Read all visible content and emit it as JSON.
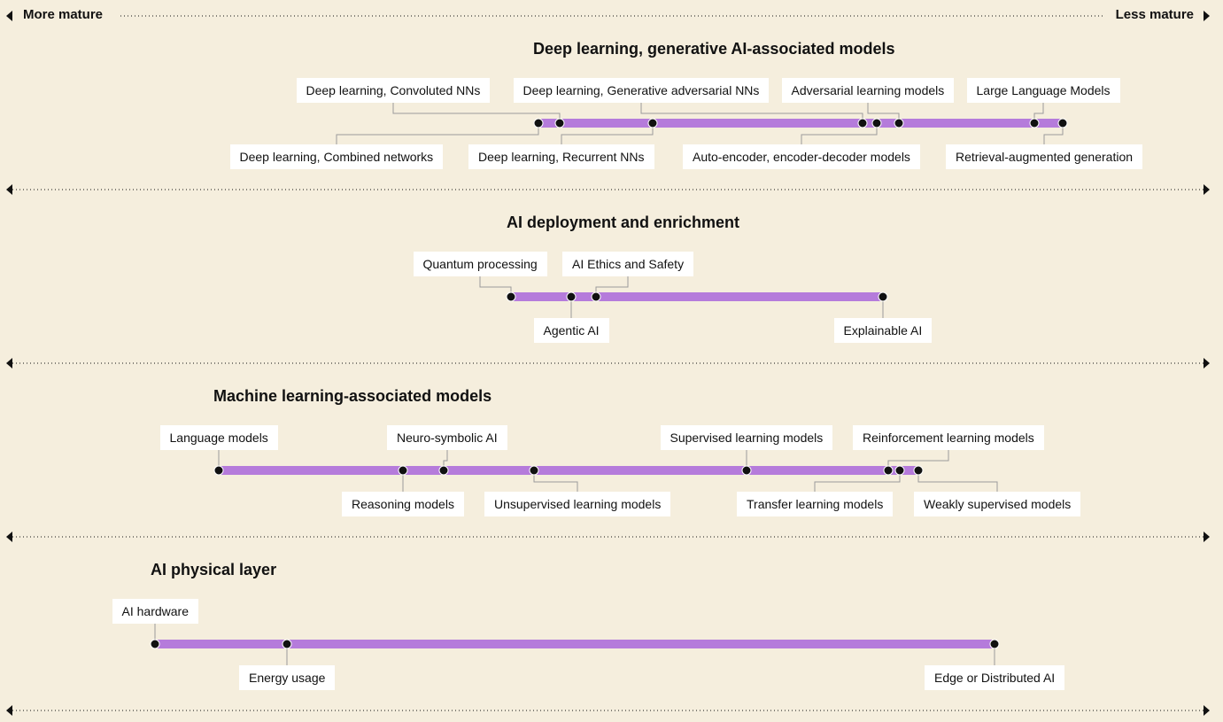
{
  "header": {
    "left_label": "More mature",
    "right_label": "Less mature"
  },
  "colors": {
    "background": "#f5eedd",
    "bar": "#b57bdb",
    "dot": "#111111",
    "label_bg": "#ffffff",
    "leader": "#9a9a9a",
    "dotted_axis": "#111111"
  },
  "chart_data": {
    "type": "timeline",
    "axis": {
      "left": "More mature",
      "right": "Less mature",
      "direction": "maturity"
    },
    "groups": [
      {
        "title": "Deep learning, generative AI-associated models",
        "items": [
          {
            "label": "Deep learning, Combined networks",
            "position": 608,
            "side": "below"
          },
          {
            "label": "Deep learning, Convoluted NNs",
            "position": 632,
            "side": "above"
          },
          {
            "label": "Deep learning, Recurrent NNs",
            "position": 737,
            "side": "below"
          },
          {
            "label": "Deep learning, Generative adversarial NNs",
            "position": 974,
            "side": "above"
          },
          {
            "label": "Auto-encoder, encoder-decoder models",
            "position": 990,
            "side": "below"
          },
          {
            "label": "Adversarial learning models",
            "position": 1015,
            "side": "above"
          },
          {
            "label": "Large Language Models",
            "position": 1168,
            "side": "above"
          },
          {
            "label": "Retrieval-augmented generation",
            "position": 1200,
            "side": "below"
          }
        ]
      },
      {
        "title": "AI deployment and enrichment",
        "items": [
          {
            "label": "Quantum processing",
            "position": 577,
            "side": "above"
          },
          {
            "label": "Agentic AI",
            "position": 645,
            "side": "below"
          },
          {
            "label": "AI Ethics and Safety",
            "position": 673,
            "side": "above"
          },
          {
            "label": "Explainable AI",
            "position": 997,
            "side": "below"
          }
        ]
      },
      {
        "title": "Machine learning-associated models",
        "items": [
          {
            "label": "Language models",
            "position": 247,
            "side": "above"
          },
          {
            "label": "Reasoning models",
            "position": 455,
            "side": "below"
          },
          {
            "label": "Neuro-symbolic AI",
            "position": 501,
            "side": "above"
          },
          {
            "label": "Unsupervised learning models",
            "position": 603,
            "side": "below"
          },
          {
            "label": "Supervised learning models",
            "position": 843,
            "side": "above"
          },
          {
            "label": "Reinforcement learning models",
            "position": 1003,
            "side": "above"
          },
          {
            "label": "Transfer learning models",
            "position": 1016,
            "side": "below"
          },
          {
            "label": "Weakly supervised models",
            "position": 1037,
            "side": "below"
          }
        ]
      },
      {
        "title": "AI physical layer",
        "items": [
          {
            "label": "AI hardware",
            "position": 175,
            "side": "above"
          },
          {
            "label": "Energy usage",
            "position": 324,
            "side": "below"
          },
          {
            "label": "Edge or Distributed AI",
            "position": 1123,
            "side": "below"
          }
        ]
      }
    ]
  }
}
